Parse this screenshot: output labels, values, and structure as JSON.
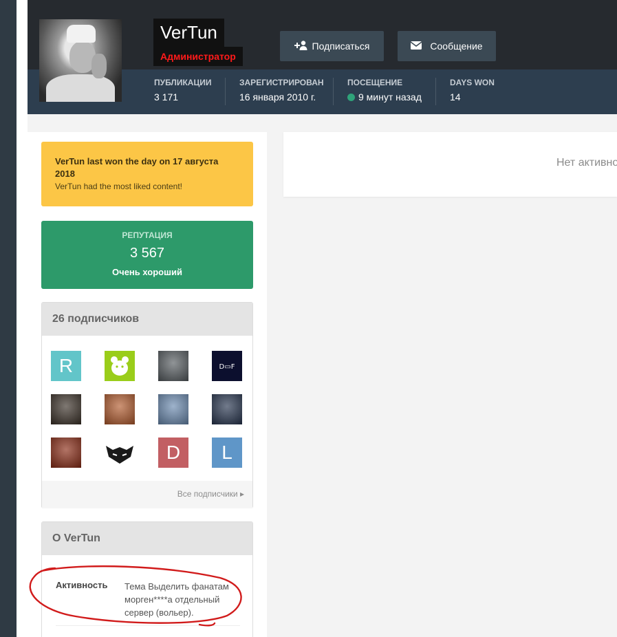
{
  "profile": {
    "username": "VerTun",
    "group": "Администратор",
    "follow_label": "Подписаться",
    "message_label": "Сообщение"
  },
  "stats": [
    {
      "label": "Публикации",
      "value": "3 171"
    },
    {
      "label": "Зарегистрирован",
      "value": "16 января 2010 г."
    },
    {
      "label": "Посещение",
      "value": "9 минут назад"
    },
    {
      "label": "Days Won",
      "value": "14"
    }
  ],
  "main": {
    "empty_text": "Нет активно"
  },
  "days_won": {
    "title": "VerTun last won the day on 17 августа 2018",
    "subtitle": "VerTun had the most liked content!"
  },
  "reputation": {
    "label": "Репутация",
    "value": "3 567",
    "description": "Очень хороший"
  },
  "followers": {
    "title": "26 подписчиков",
    "all_label": "Все подписчики",
    "avatars": [
      {
        "letter": "R",
        "color": "#62c5c9"
      },
      {
        "letter": "",
        "color": "#9acd1a",
        "icon": "bear-icon"
      },
      {
        "letter": "",
        "color": "#555b5f",
        "icon": "photo-man-icon"
      },
      {
        "letter": "",
        "color": "#0c0f2e",
        "icon": "df-logo-icon"
      },
      {
        "letter": "",
        "color": "#3a3027",
        "icon": "photo-helmet-icon"
      },
      {
        "letter": "",
        "color": "#b25a2c",
        "icon": "photo-face-icon"
      },
      {
        "letter": "",
        "color": "#6a8ab0",
        "icon": "photo-plane-icon"
      },
      {
        "letter": "",
        "color": "#26344e",
        "icon": "photo-pilot-icon"
      },
      {
        "letter": "",
        "color": "#8a2a14",
        "icon": "photo-spartan-icon"
      },
      {
        "letter": "",
        "color": "#ffffff",
        "icon": "cat-mask-icon"
      },
      {
        "letter": "D",
        "color": "#c25f63"
      },
      {
        "letter": "L",
        "color": "#5f96c8"
      }
    ]
  },
  "about": {
    "title": "О VerTun",
    "activity_label": "Активность",
    "activity_value": "Тема Выделить фанатам морген****а отдельный сервер (вольер)."
  }
}
